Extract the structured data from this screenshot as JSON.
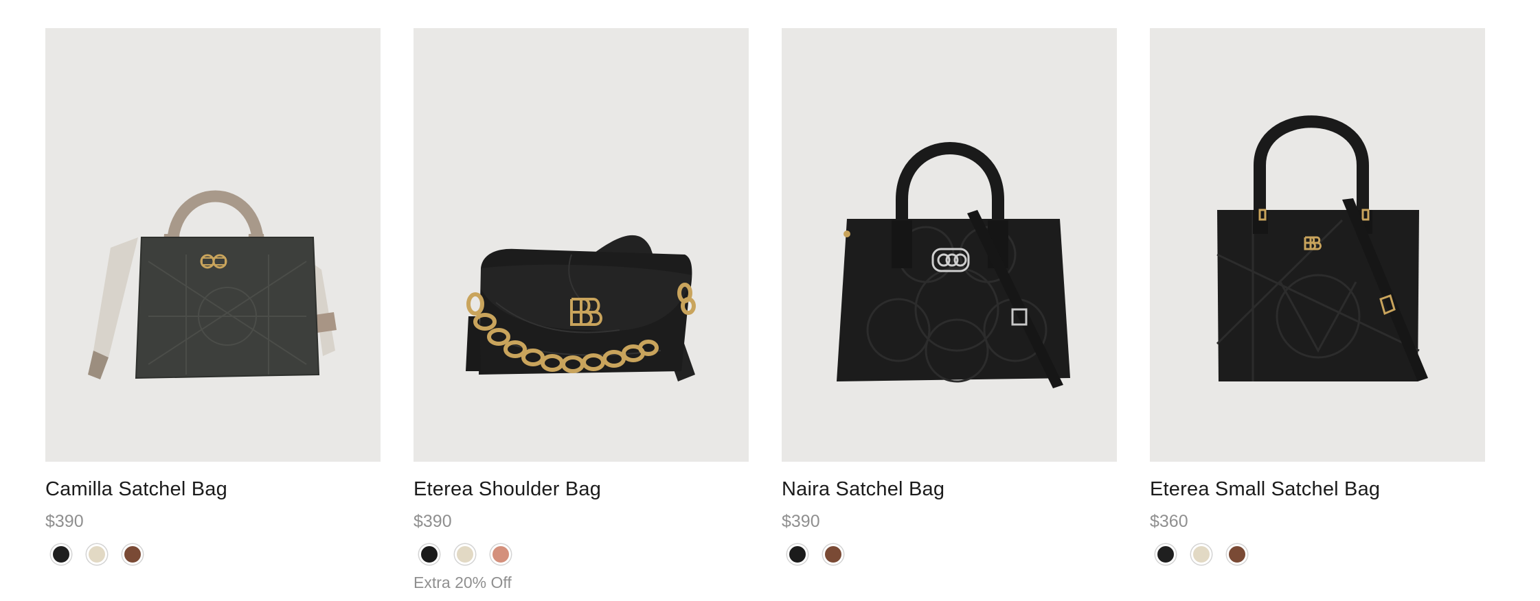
{
  "products": [
    {
      "name": "Camilla Satchel Bag",
      "price": "$390",
      "swatches": [
        {
          "color": "#1f1f1f",
          "name": "black-swatch"
        },
        {
          "color": "#e2d9c4",
          "name": "cream-swatch"
        },
        {
          "color": "#7a4a35",
          "name": "brown-swatch"
        }
      ],
      "promo": ""
    },
    {
      "name": "Eterea Shoulder Bag",
      "price": "$390",
      "swatches": [
        {
          "color": "#1b1b1b",
          "name": "black-swatch"
        },
        {
          "color": "#e2d9c4",
          "name": "cream-swatch"
        },
        {
          "color": "#d4907c",
          "name": "rose-swatch"
        }
      ],
      "promo": "Extra 20% Off"
    },
    {
      "name": "Naira Satchel Bag",
      "price": "$390",
      "swatches": [
        {
          "color": "#1b1b1b",
          "name": "black-swatch"
        },
        {
          "color": "#7a4a35",
          "name": "brown-swatch"
        }
      ],
      "promo": ""
    },
    {
      "name": "Eterea Small Satchel Bag",
      "price": "$360",
      "swatches": [
        {
          "color": "#1f1f1f",
          "name": "black-swatch"
        },
        {
          "color": "#e2d9c4",
          "name": "cream-swatch"
        },
        {
          "color": "#7a4a35",
          "name": "brown-swatch"
        }
      ],
      "promo": ""
    }
  ],
  "colors": {
    "image_background": "#e9e8e6",
    "price_text": "#8f8f8f",
    "bag_black": "#1c1c1c",
    "hardware_gold": "#c9a45c"
  },
  "icons": [
    "camilla-satchel-bag-image",
    "eterea-shoulder-bag-image",
    "naira-satchel-bag-image",
    "eterea-small-satchel-bag-image"
  ]
}
